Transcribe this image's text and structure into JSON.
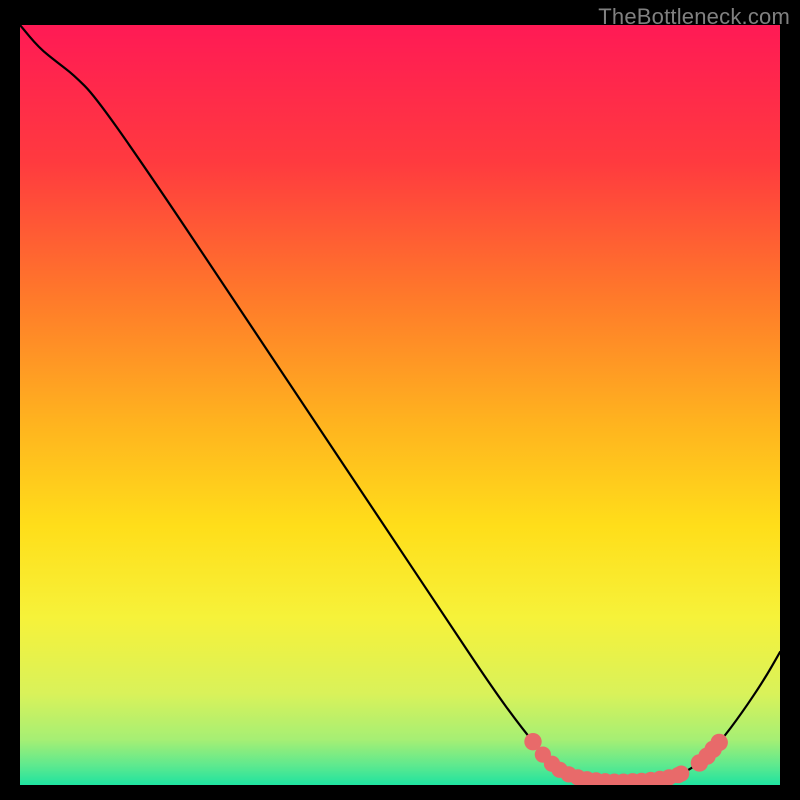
{
  "attribution": {
    "text": "TheBottleneck.com"
  },
  "chart_data": {
    "type": "line",
    "title": "",
    "xlabel": "",
    "ylabel": "",
    "xlim": [
      0,
      100
    ],
    "ylim": [
      0,
      100
    ],
    "gradient_stops": [
      {
        "offset": 0.0,
        "color": "#ff1a55"
      },
      {
        "offset": 0.18,
        "color": "#ff3a3f"
      },
      {
        "offset": 0.36,
        "color": "#ff7a2a"
      },
      {
        "offset": 0.52,
        "color": "#ffb21f"
      },
      {
        "offset": 0.66,
        "color": "#ffde1a"
      },
      {
        "offset": 0.78,
        "color": "#f6f23a"
      },
      {
        "offset": 0.88,
        "color": "#d9f25a"
      },
      {
        "offset": 0.94,
        "color": "#a6ef74"
      },
      {
        "offset": 0.975,
        "color": "#5ce98f"
      },
      {
        "offset": 1.0,
        "color": "#1fe3a0"
      }
    ],
    "curve": [
      {
        "x": 0.0,
        "y": 100.0
      },
      {
        "x": 2.5,
        "y": 97.0
      },
      {
        "x": 5.0,
        "y": 95.0
      },
      {
        "x": 7.0,
        "y": 93.5
      },
      {
        "x": 10.0,
        "y": 90.5
      },
      {
        "x": 18.0,
        "y": 79.0
      },
      {
        "x": 28.0,
        "y": 64.0
      },
      {
        "x": 38.0,
        "y": 49.0
      },
      {
        "x": 48.0,
        "y": 34.0
      },
      {
        "x": 56.0,
        "y": 22.0
      },
      {
        "x": 62.0,
        "y": 13.0
      },
      {
        "x": 66.0,
        "y": 7.5
      },
      {
        "x": 69.5,
        "y": 3.3
      },
      {
        "x": 72.0,
        "y": 1.6
      },
      {
        "x": 75.0,
        "y": 0.8
      },
      {
        "x": 78.0,
        "y": 0.5
      },
      {
        "x": 82.0,
        "y": 0.5
      },
      {
        "x": 86.0,
        "y": 1.0
      },
      {
        "x": 89.0,
        "y": 2.5
      },
      {
        "x": 92.0,
        "y": 5.5
      },
      {
        "x": 95.0,
        "y": 9.5
      },
      {
        "x": 98.0,
        "y": 14.0
      },
      {
        "x": 100.0,
        "y": 17.5
      }
    ],
    "markers": [
      {
        "x": 67.5,
        "y": 5.7,
        "r": 1.0
      },
      {
        "x": 68.8,
        "y": 4.0,
        "r": 0.9
      },
      {
        "x": 70.0,
        "y": 2.8,
        "r": 0.9
      },
      {
        "x": 71.0,
        "y": 2.0,
        "r": 0.9
      },
      {
        "x": 72.2,
        "y": 1.4,
        "r": 0.9
      },
      {
        "x": 73.4,
        "y": 1.0,
        "r": 0.9
      },
      {
        "x": 74.6,
        "y": 0.75,
        "r": 0.9
      },
      {
        "x": 75.8,
        "y": 0.6,
        "r": 0.9
      },
      {
        "x": 77.0,
        "y": 0.5,
        "r": 0.9
      },
      {
        "x": 78.2,
        "y": 0.45,
        "r": 0.9
      },
      {
        "x": 79.4,
        "y": 0.45,
        "r": 0.9
      },
      {
        "x": 80.6,
        "y": 0.5,
        "r": 0.9
      },
      {
        "x": 81.8,
        "y": 0.55,
        "r": 0.9
      },
      {
        "x": 83.0,
        "y": 0.65,
        "r": 0.9
      },
      {
        "x": 84.2,
        "y": 0.8,
        "r": 0.9
      },
      {
        "x": 85.4,
        "y": 1.0,
        "r": 0.9
      },
      {
        "x": 86.6,
        "y": 1.3,
        "r": 0.9
      },
      {
        "x": 87.0,
        "y": 1.5,
        "r": 0.9
      },
      {
        "x": 89.4,
        "y": 2.9,
        "r": 1.0
      },
      {
        "x": 90.4,
        "y": 3.8,
        "r": 1.0
      },
      {
        "x": 91.2,
        "y": 4.7,
        "r": 1.0
      },
      {
        "x": 92.0,
        "y": 5.6,
        "r": 1.0
      }
    ],
    "marker_color": "#e86a6a",
    "curve_color": "#000000"
  }
}
